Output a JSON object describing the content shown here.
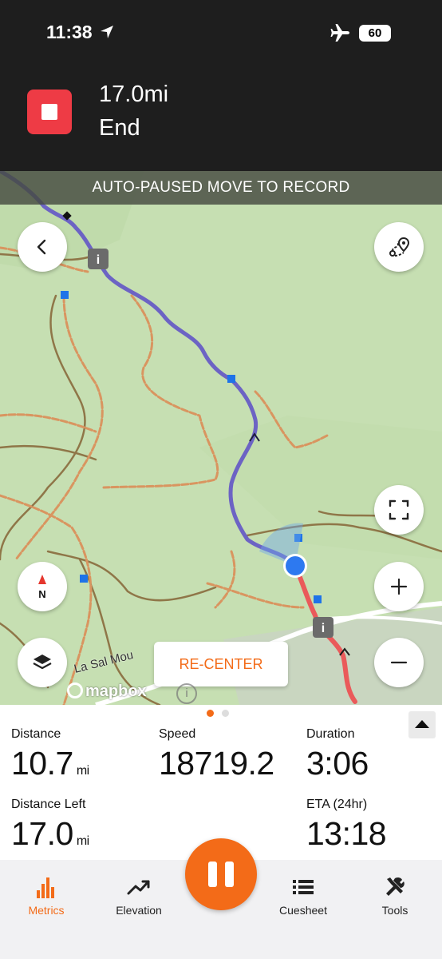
{
  "status_bar": {
    "time": "11:38",
    "battery": "60"
  },
  "nav_banner": {
    "distance": "17.0mi",
    "instruction": "End"
  },
  "map": {
    "autopause_text": "AUTO-PAUSED MOVE TO RECORD",
    "recenter_label": "RE-CENTER",
    "road_label": "La Sal Mou",
    "attribution": "mapbox",
    "compass_label": "N",
    "colors": {
      "route_done": "#6c63c4",
      "route_ahead": "#ea5a5a",
      "trail": "#d99560",
      "contour": "#8f7648",
      "position": "#2d79f0"
    }
  },
  "metrics": {
    "page_indicator": {
      "current": 1,
      "total": 2
    },
    "distance": {
      "label": "Distance",
      "value": "10.7",
      "unit": "mi"
    },
    "speed": {
      "label": "Speed",
      "value": "18719.2"
    },
    "duration": {
      "label": "Duration",
      "value": "3:06"
    },
    "distance_left": {
      "label": "Distance Left",
      "value": "17.0",
      "unit": "mi"
    },
    "eta": {
      "label": "ETA (24hr)",
      "value": "13:18"
    }
  },
  "tabs": [
    {
      "label": "Metrics",
      "icon": "bar-chart-icon",
      "active": true
    },
    {
      "label": "Elevation",
      "icon": "trend-line-icon",
      "active": false
    },
    {
      "label": "Cuesheet",
      "icon": "list-icon",
      "active": false
    },
    {
      "label": "Tools",
      "icon": "tools-icon",
      "active": false
    }
  ],
  "accent_color": "#f36b18"
}
